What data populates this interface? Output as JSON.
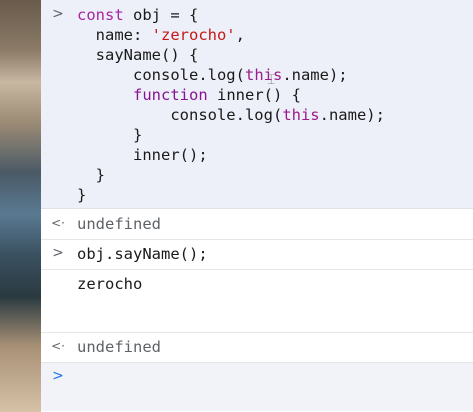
{
  "code_block": {
    "lines": [
      [
        "const obj = {"
      ],
      [
        "  name: 'zerocho',"
      ],
      [
        "  sayName() {"
      ],
      [
        "      console.log(this.name);"
      ],
      [
        "      function inner() {"
      ],
      [
        "          console.log(this.name);"
      ],
      [
        "      }"
      ],
      [
        "      inner();"
      ],
      [
        "  }"
      ],
      [
        "}"
      ]
    ],
    "l1_kw": "const",
    "l1_rest": " obj = {",
    "l2_pre": "  name: ",
    "l2_str": "'zerocho'",
    "l2_post": ",",
    "l3": "  sayName() {",
    "l4_pre": "      console.log(",
    "l4_this": "this",
    "l4_post": ".name);",
    "l5_kw": "function",
    "l5_pre": "      ",
    "l5_post": " inner() {",
    "l6_pre": "          console.log(",
    "l6_this": "this",
    "l6_post": ".name);",
    "l7": "      }",
    "l8": "      inner();",
    "l9": "  }",
    "l10": "}"
  },
  "entries": {
    "input_prompt": ">",
    "result_arrow": "<·",
    "result1": "undefined",
    "call_input": "obj.sayName();",
    "output1": "zerocho",
    "result2": "undefined",
    "final_prompt": ">"
  }
}
